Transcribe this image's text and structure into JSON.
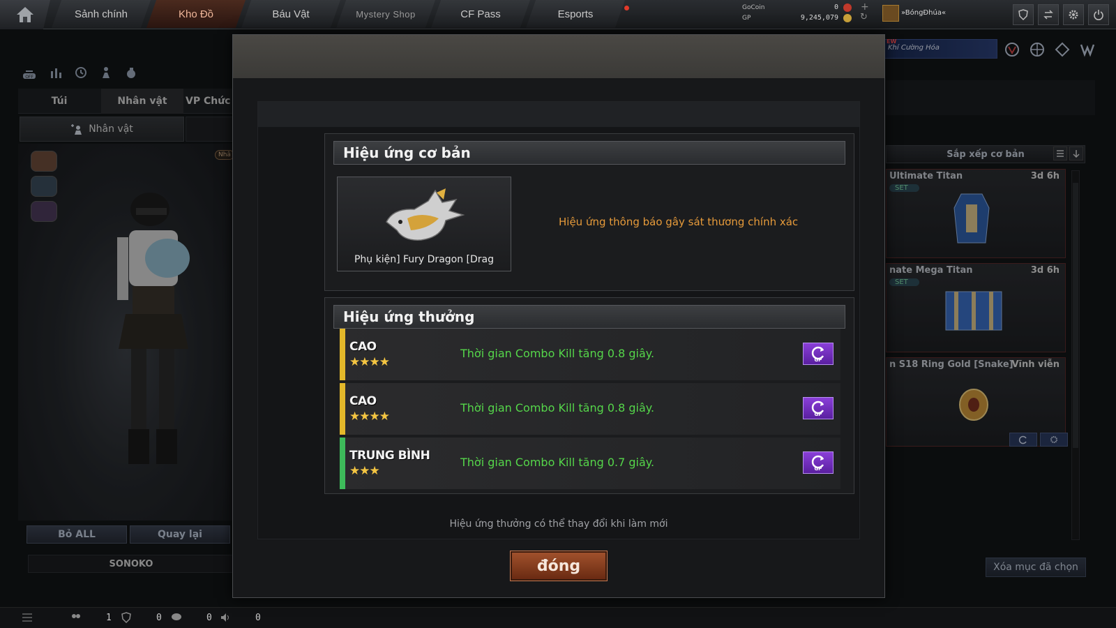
{
  "topnav": {
    "tabs": [
      {
        "label": "Sảnh chính"
      },
      {
        "label": "Kho Đồ"
      },
      {
        "label": "Báu Vật"
      },
      {
        "label": "Mystery Shop"
      },
      {
        "label": "CF Pass"
      },
      {
        "label": "Esports"
      }
    ],
    "active_tab": "Kho Đồ",
    "gocoin_label": "GoCoin",
    "gocoin_value": "0",
    "gp_label": "GP",
    "gp_value": "9,245,079",
    "player_name": "»BóngĐhúa«"
  },
  "left_panel": {
    "tabs": [
      "Túi",
      "Nhân vật",
      "VP Chức"
    ],
    "active_tab": "Nhân vật",
    "sub_tab": "Nhân vật",
    "badge": "Nhâ",
    "buttons": {
      "remove_all": "Bỏ ALL",
      "back": "Quay lại"
    },
    "character_name": "SONOKO"
  },
  "right_panel": {
    "banner_text": "Khí Cường Hóa",
    "banner_new": "EW",
    "sort_label": "Sắp xếp cơ bản",
    "items": [
      {
        "name": "Ultimate Titan",
        "duration": "3d 6h",
        "set": "SET",
        "color": "#2f5fa8"
      },
      {
        "name": "nate Mega Titan",
        "duration": "3d 6h",
        "set": "SET",
        "color": "#3a6cc0"
      },
      {
        "name": "n S18 Ring Gold [Snake]",
        "duration": "Vĩnh viễn",
        "set": "",
        "color": "#c8923a"
      }
    ],
    "clear_selected": "Xóa mục đã chọn"
  },
  "statusbar": {
    "values": [
      "1",
      "0",
      "0",
      "0"
    ]
  },
  "modal": {
    "basic_section_title": "Hiệu ứng cơ bản",
    "item_name": "Phụ kiện] Fury Dragon [Drag",
    "basic_effect": "Hiệu ứng thông báo gây sát thương chính xác",
    "bonus_section_title": "Hiệu ứng thưởng",
    "bonus_rows": [
      {
        "tier": "CAO",
        "stars": "★★★★",
        "text": "Thời gian Combo Kill tăng 0.8 giây.",
        "bar_color": "#e3b82a"
      },
      {
        "tier": "CAO",
        "stars": "★★★★",
        "text": "Thời gian Combo Kill tăng 0.8 giây.",
        "bar_color": "#e3b82a"
      },
      {
        "tier": "TRUNG BÌNH",
        "stars": "★★★",
        "text": "Thời gian Combo Kill tăng 0.7 giây.",
        "bar_color": "#3dbb5a"
      }
    ],
    "note": "Hiệu ứng thưởng có thể thay đổi khi làm mới",
    "close_label": "đóng"
  },
  "colors": {
    "accent_orange": "#e69a3a",
    "bonus_green": "#55d64a",
    "star_gold": "#f4c542"
  }
}
